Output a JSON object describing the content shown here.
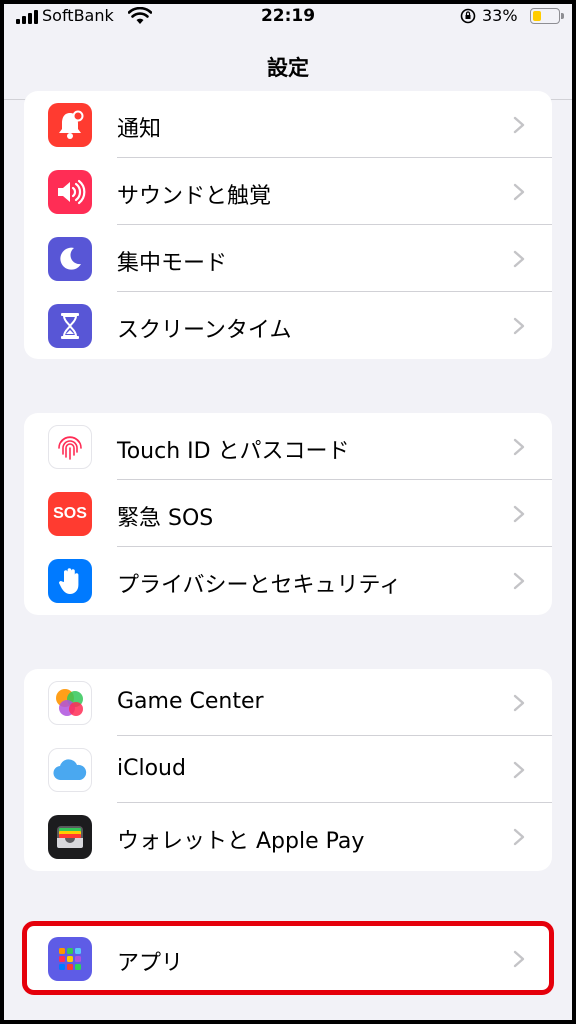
{
  "status_bar": {
    "carrier": "SoftBank",
    "time": "22:19",
    "battery_percent": "33%",
    "battery_level": 0.33,
    "battery_color": "#ffcc00"
  },
  "nav": {
    "title": "設定"
  },
  "groups": [
    {
      "items": [
        {
          "label": "通知",
          "icon": "notifications-icon",
          "color": "#ff3b30"
        },
        {
          "label": "サウンドと触覚",
          "icon": "sound-icon",
          "color": "#ff2d55"
        },
        {
          "label": "集中モード",
          "icon": "moon-icon",
          "color": "#5856d6"
        },
        {
          "label": "スクリーンタイム",
          "icon": "hourglass-icon",
          "color": "#5856d6"
        }
      ]
    },
    {
      "items": [
        {
          "label": "Touch ID とパスコード",
          "icon": "fingerprint-icon",
          "color": "#ffffff"
        },
        {
          "label": "緊急 SOS",
          "icon": "sos-icon",
          "color": "#ff3b30",
          "icon_text": "SOS"
        },
        {
          "label": "プライバシーとセキュリティ",
          "icon": "hand-icon",
          "color": "#007aff"
        }
      ]
    },
    {
      "items": [
        {
          "label": "Game Center",
          "icon": "game-center-icon",
          "color": "#ffffff"
        },
        {
          "label": "iCloud",
          "icon": "icloud-icon",
          "color": "#ffffff"
        },
        {
          "label": "ウォレットと Apple Pay",
          "icon": "wallet-icon",
          "color": "#1c1c1e"
        }
      ]
    },
    {
      "items": [
        {
          "label": "アプリ",
          "icon": "apps-icon",
          "color": "#5e5ce6"
        }
      ]
    }
  ],
  "highlight_color": "#e5000b"
}
